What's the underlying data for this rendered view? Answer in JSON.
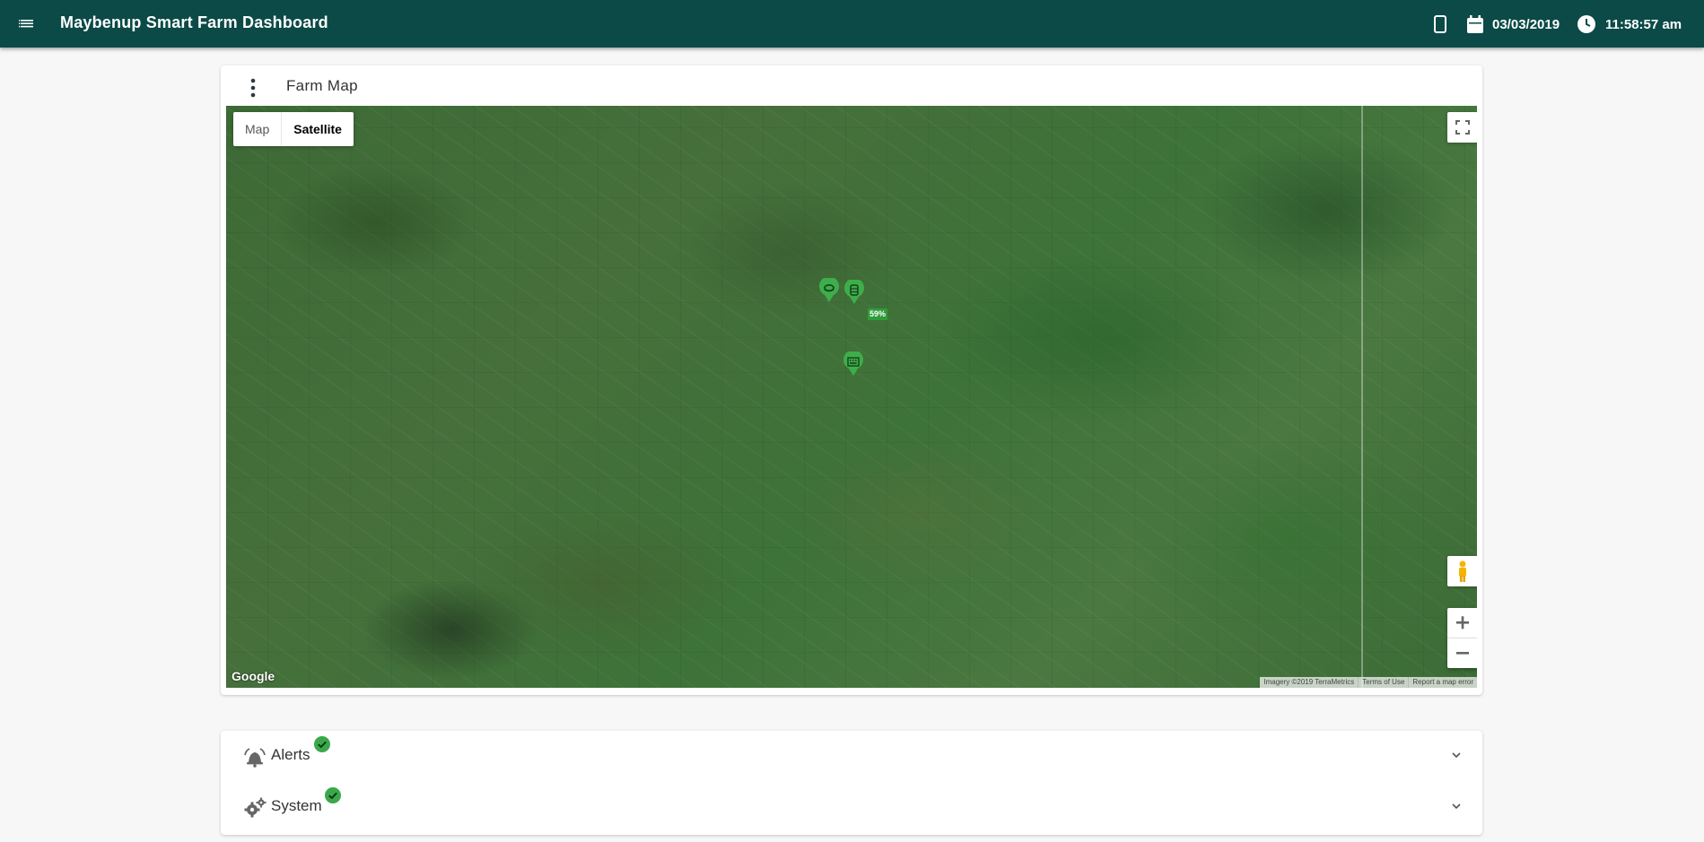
{
  "header": {
    "menu_icon": "menu-icon",
    "title": "Maybenup Smart Farm Dashboard",
    "device_icon": "tablet-icon",
    "date_icon": "calendar-icon",
    "date": "03/03/2019",
    "time_icon": "clock-icon",
    "time": "11:58:57 am",
    "background_color": "#0b4a47"
  },
  "map_card": {
    "title": "Farm Map",
    "menu_icon": "more-vert-icon",
    "map_type": {
      "map_label": "Map",
      "satellite_label": "Satellite",
      "selected": "Satellite"
    },
    "controls": {
      "fullscreen_icon": "fullscreen-icon",
      "pegman_icon": "pegman-icon",
      "zoom_in": "+",
      "zoom_out": "−"
    },
    "logo_text": "Google",
    "attribution": [
      "Imagery ©2019 TerraMetrics",
      "Terms of Use",
      "Report a map error"
    ],
    "markers": [
      {
        "name": "silo-marker",
        "icon": "layers-icon"
      },
      {
        "name": "tank-marker",
        "icon": "database-icon",
        "level": "59%"
      },
      {
        "name": "station-marker",
        "icon": "keyboard-icon"
      }
    ],
    "marker_color": "#3eae4a"
  },
  "accordion": [
    {
      "label": "Alerts",
      "icon": "bell-alert-icon",
      "status": "ok",
      "status_icon": "check-circle-icon"
    },
    {
      "label": "System",
      "icon": "gears-icon",
      "status": "ok",
      "status_icon": "check-circle-icon"
    }
  ],
  "status_color": "#3aa84a"
}
